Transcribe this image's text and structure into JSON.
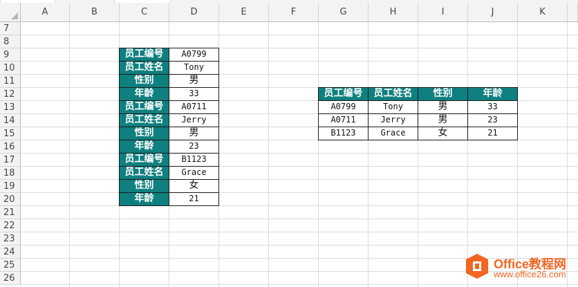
{
  "columns": [
    "A",
    "B",
    "C",
    "D",
    "E",
    "F",
    "G",
    "H",
    "I",
    "J",
    "K"
  ],
  "rows": [
    "7",
    "8",
    "9",
    "10",
    "11",
    "12",
    "13",
    "14",
    "15",
    "16",
    "17",
    "18",
    "19",
    "20",
    "21",
    "22",
    "23",
    "24",
    "25",
    "26"
  ],
  "source_table": [
    {
      "label": "员工编号",
      "value": "A0799"
    },
    {
      "label": "员工姓名",
      "value": "Tony"
    },
    {
      "label": "性别",
      "value": "男"
    },
    {
      "label": "年龄",
      "value": "33"
    },
    {
      "label": "员工编号",
      "value": "A0711"
    },
    {
      "label": "员工姓名",
      "value": "Jerry"
    },
    {
      "label": "性别",
      "value": "男"
    },
    {
      "label": "年龄",
      "value": "23"
    },
    {
      "label": "员工编号",
      "value": "B1123"
    },
    {
      "label": "员工姓名",
      "value": "Grace"
    },
    {
      "label": "性别",
      "value": "女"
    },
    {
      "label": "年龄",
      "value": "21"
    }
  ],
  "result_table": {
    "headers": [
      "员工编号",
      "员工姓名",
      "性别",
      "年龄"
    ],
    "rows": [
      [
        "A0799",
        "Tony",
        "男",
        "33"
      ],
      [
        "A0711",
        "Jerry",
        "男",
        "23"
      ],
      [
        "B1123",
        "Grace",
        "女",
        "21"
      ]
    ]
  },
  "watermark": {
    "brand": "Office教程网",
    "url": "www.office26.com"
  },
  "colors": {
    "header_fill": "#107f7f",
    "header_text": "#ffffff",
    "brand": "#f26522"
  }
}
